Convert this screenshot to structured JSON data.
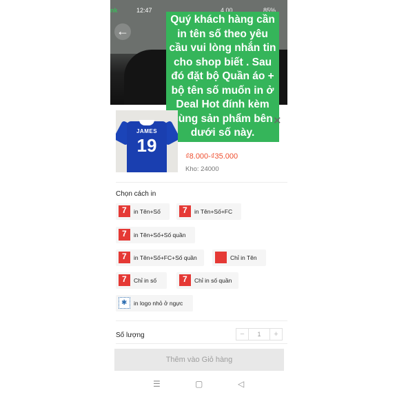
{
  "status_bar": {
    "time": "12:47",
    "brand_fragment": "nk",
    "status_text": "4.00",
    "battery": "85%"
  },
  "notice": {
    "text": "Quý khách hàng cần in tên số theo yêu cầu vui lòng nhắn tin cho shop biết . Sau đó đặt bộ Quần áo + bộ tên số muốn in ở Deal Hot đính kèm cùng sản phẩm bên dưới số này."
  },
  "product": {
    "thumb_name": "JAMES",
    "thumb_number": "19",
    "price": "₫8.000-₫35.000",
    "stock": "Kho: 24000"
  },
  "print_section": {
    "title": "Chọn cách in",
    "options": [
      {
        "label": "in Tên+Số",
        "icon": "seven-badge-icon"
      },
      {
        "label": "in Tên+Số+FC",
        "icon": "seven-badge-icon"
      },
      {
        "label": "in Tên+Số+Số quần",
        "icon": "seven-badge-icon"
      },
      {
        "label": "in Tên+Số+FC+Số quần",
        "icon": "seven-badge-icon"
      },
      {
        "label": "Chỉ in Tên",
        "icon": "red-badge-icon"
      },
      {
        "label": "Chỉ in số",
        "icon": "seven-badge-icon"
      },
      {
        "label": "Chỉ in số quần",
        "icon": "seven-badge-icon"
      },
      {
        "label": "in logo nhỏ ở ngực",
        "icon": "logo-badge-icon"
      }
    ]
  },
  "quantity": {
    "label": "Số lượng",
    "minus": "−",
    "value": "1",
    "plus": "+"
  },
  "cart_button": {
    "label": "Thêm vào Giỏ hàng"
  },
  "nav": {
    "menu": "☰",
    "home": "▢",
    "back": "◁"
  },
  "colors": {
    "notice_bg": "#35b55a",
    "price": "#ee4d2d",
    "badge": "#e53935",
    "jersey": "#1a3fb0"
  }
}
